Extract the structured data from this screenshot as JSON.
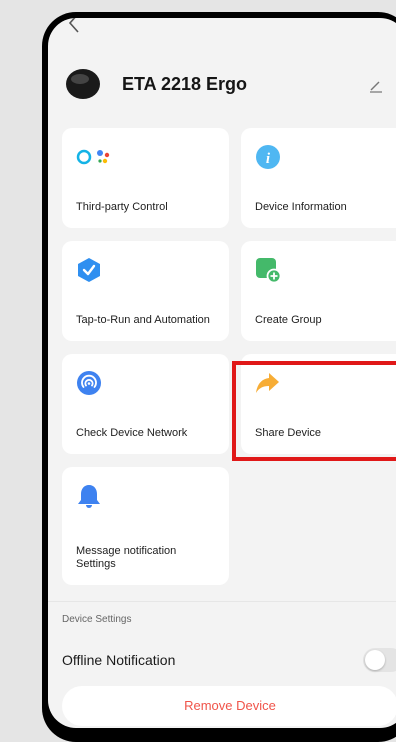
{
  "header": {
    "device_name": "ETA 2218 Ergo"
  },
  "cards": [
    {
      "label": "Third-party Control",
      "icon": "alexa-google-assistant-icon"
    },
    {
      "label": "Device Information",
      "icon": "info-icon"
    },
    {
      "label": "Tap-to-Run and Automation",
      "icon": "automation-check-icon"
    },
    {
      "label": "Create Group",
      "icon": "create-group-icon"
    },
    {
      "label": "Check Device Network",
      "icon": "network-icon"
    },
    {
      "label": "Share Device",
      "icon": "share-arrow-icon"
    },
    {
      "label": "Message notification Settings",
      "icon": "bell-icon"
    }
  ],
  "settings": {
    "section_title": "Device Settings",
    "offline_notification_label": "Offline Notification",
    "offline_notification_enabled": false
  },
  "remove_button_label": "Remove Device",
  "colors": {
    "highlight": "#e01818",
    "remove_text": "#f0544a",
    "info_blue": "#4fb7f2",
    "automation_blue": "#2f8ff0",
    "group_green": "#44b96a",
    "share_orange": "#f7ad36"
  }
}
